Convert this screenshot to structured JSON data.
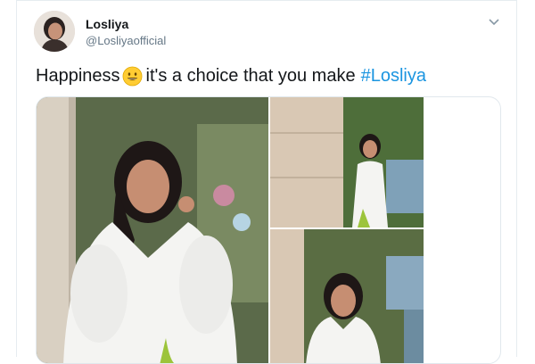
{
  "user": {
    "name": "Losliya",
    "handle": "@Losliyaofficial"
  },
  "tweet": {
    "text_before_emoji": "Happiness",
    "emoji": "grinning-face-emoji",
    "text_after_emoji": "it's a choice that you make",
    "hashtag": "#Losliya"
  },
  "media": {
    "photos": [
      "woman-in-white-dress-leaning-on-wall",
      "woman-standing-by-wall-full-length",
      "woman-by-wall-in-white-dress"
    ]
  },
  "colors": {
    "text": "#14171a",
    "secondary": "#657786",
    "link": "#1b95e0",
    "border": "#e1e8ed"
  }
}
